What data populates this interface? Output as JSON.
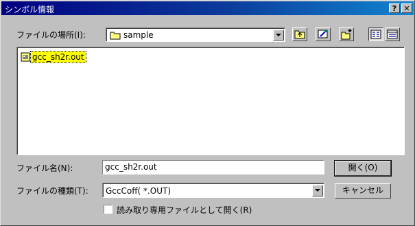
{
  "window": {
    "title": "シンボル情報",
    "help_label": "?",
    "close_label": "✕"
  },
  "lookin": {
    "label": "ファイルの場所(I):",
    "value": "sample",
    "icon": "folder-icon"
  },
  "toolbar": {
    "icons": [
      "up-folder-icon",
      "desktop-icon",
      "new-folder-icon",
      "list-view-icon",
      "details-view-icon"
    ]
  },
  "files": [
    {
      "name": "gcc_sh2r.out",
      "icon": "file-icon",
      "selected": true
    }
  ],
  "filename": {
    "label": "ファイル名(N):",
    "value": "gcc_sh2r.out"
  },
  "filetype": {
    "label": "ファイルの種類(T):",
    "value": "GccCoff( *.OUT)"
  },
  "buttons": {
    "open": "開く(O)",
    "cancel": "キャンセル"
  },
  "readonly": {
    "label": "読み取り専用ファイルとして開く(R)",
    "checked": false
  },
  "colors": {
    "title_bar": "#000080",
    "dialog_bg": "#c0c0c0",
    "selection": "#ffff00"
  }
}
